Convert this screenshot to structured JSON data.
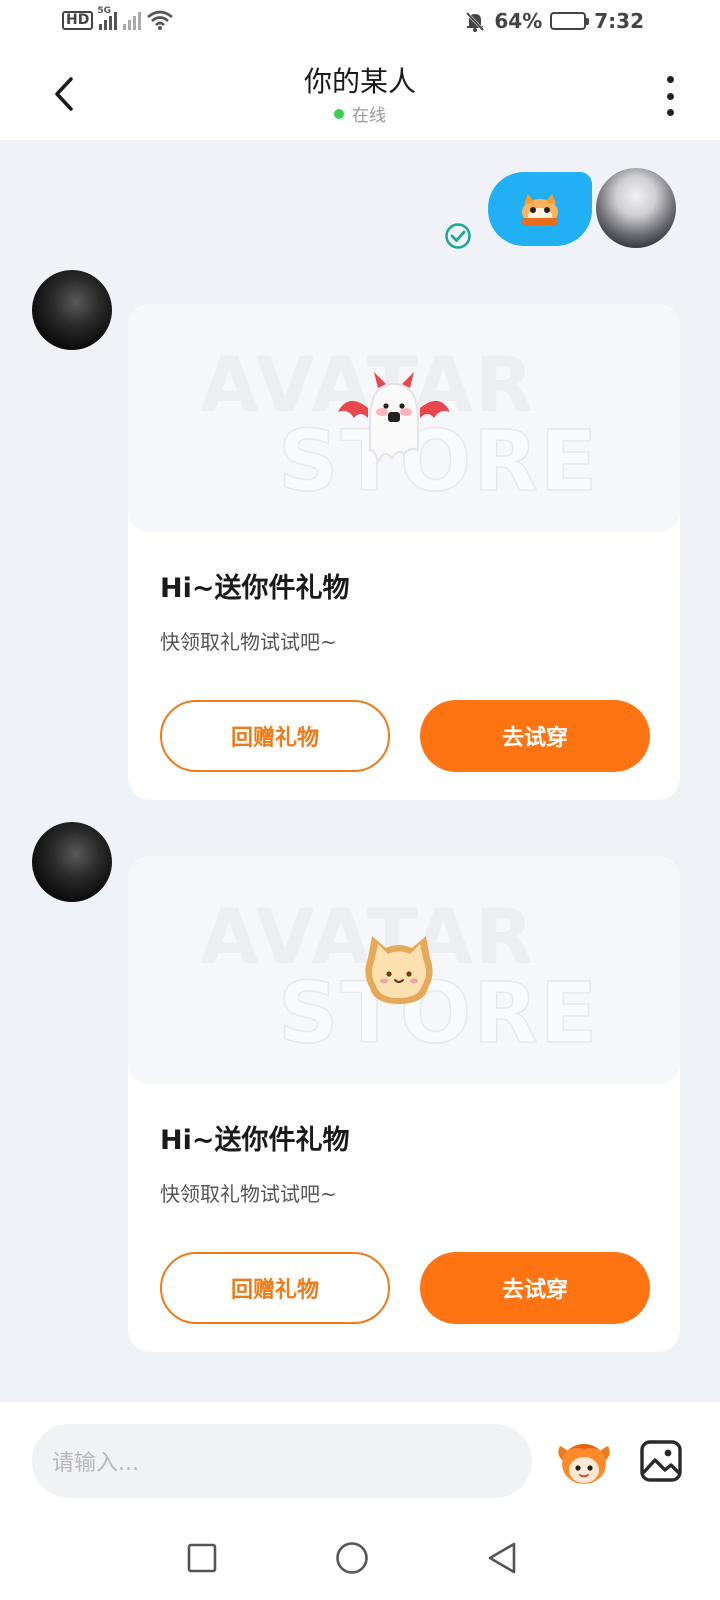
{
  "status_bar": {
    "hd_label": "HD",
    "network_label": "5G",
    "battery_text": "64%",
    "battery_level": 0.64,
    "time": "7:32",
    "icons": [
      "signal-icon",
      "wifi-icon",
      "mute-bell-icon",
      "battery-icon"
    ]
  },
  "header": {
    "title": "你的某人",
    "status": "在线",
    "status_color": "#3ccf4e"
  },
  "messages": [
    {
      "type": "sticker",
      "direction": "sent",
      "sticker": "cat-peek-sticker",
      "read_icon": "check-circle-icon"
    },
    {
      "type": "gift_card",
      "direction": "received",
      "watermark_line1": "AVATAR",
      "watermark_line2": "STORE",
      "gift": "ghost-devil-icon",
      "title": "Hi~送你件礼物",
      "subtitle": "快领取礼物试试吧~",
      "secondary_button": "回赠礼物",
      "primary_button": "去试穿"
    },
    {
      "type": "gift_card",
      "direction": "received",
      "watermark_line1": "AVATAR",
      "watermark_line2": "STORE",
      "gift": "toast-cat-icon",
      "title": "Hi~送你件礼物",
      "subtitle": "快领取礼物试试吧~",
      "secondary_button": "回赠礼物",
      "primary_button": "去试穿"
    }
  ],
  "input_bar": {
    "placeholder": "请输入..."
  },
  "colors": {
    "accent": "#ff7412",
    "sent_bubble": "#22b0f5",
    "read_check": "#1aa890"
  }
}
